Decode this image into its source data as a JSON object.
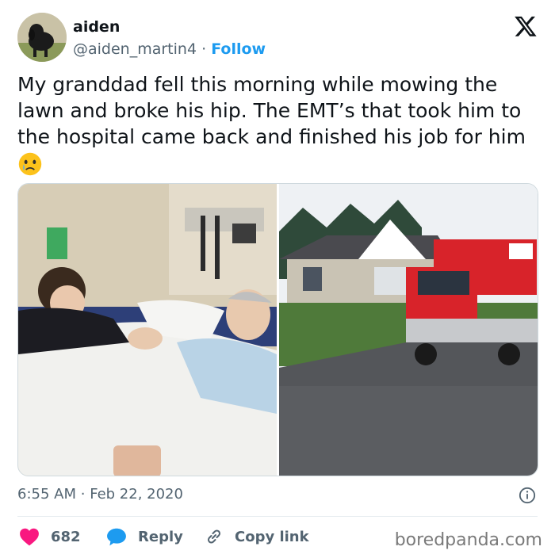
{
  "author": {
    "name": "aiden",
    "handle": "@aiden_martin4",
    "separator": "·",
    "follow_label": "Follow"
  },
  "tweet": {
    "text": "My granddad fell this morning while mowing the lawn and broke his hip. The EMT’s that took him to the hospital came back and finished his job for him",
    "emoji": "crying-face"
  },
  "meta": {
    "time": "6:55 AM",
    "separator": "·",
    "date": "Feb 22, 2020"
  },
  "actions": {
    "likes_count": "682",
    "reply_label": "Reply",
    "copy_link_label": "Copy link"
  },
  "watermark": "boredpanda.com",
  "icons": {
    "platform": "x-logo-icon",
    "info": "info-icon",
    "like": "heart-icon",
    "reply": "speech-bubble-icon",
    "link": "link-icon"
  },
  "colors": {
    "accent": "#1d9bf0",
    "like": "#f91880",
    "text": "#0f1419",
    "muted": "#536471",
    "ambulance_red": "#d8232a"
  }
}
